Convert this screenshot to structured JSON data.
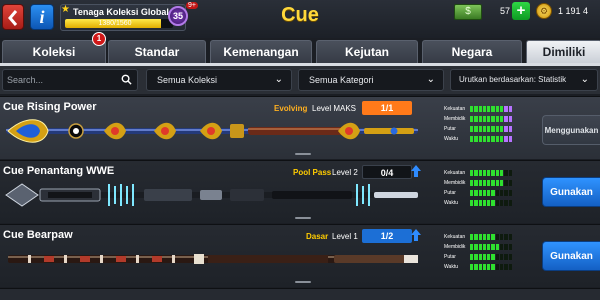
{
  "topbar": {
    "title": "Cue",
    "back_icon": "chevron-left-icon",
    "info_label": "i",
    "collection": {
      "title": "Tenaga Koleksi Global",
      "count": "1380/1560",
      "progress": 0.885,
      "level": "35",
      "level_plus": "9+"
    },
    "cash": {
      "value": "57",
      "add_label": "+"
    },
    "coins": {
      "value": "1 191 4"
    }
  },
  "tabs": [
    {
      "label": "Koleksi",
      "badge": "1"
    },
    {
      "label": "Standar"
    },
    {
      "label": "Kemenangan"
    },
    {
      "label": "Kejutan"
    },
    {
      "label": "Negara"
    },
    {
      "label": "Dimiliki",
      "active": true
    }
  ],
  "filters": {
    "search_placeholder": "Search...",
    "collection_filter": "Semua Koleksi",
    "category_filter": "Semua Kategori",
    "sort_filter": "Urutkan berdasarkan: Statistik"
  },
  "stat_labels": [
    "Kekuatan",
    "Membidik",
    "Putar",
    "Waktu"
  ],
  "cues": [
    {
      "name": "Cue Rising Power",
      "tier": "Evolving",
      "tier_color": "#ffb020",
      "level_text": "Level MAKS",
      "progress": "1/1",
      "progress_color": "#ff7a1a",
      "stats": [
        10,
        10,
        10,
        10
      ],
      "max_stats": true,
      "action": "Menggunakan",
      "action_type": "inuse"
    },
    {
      "name": "Cue Penantang WWE",
      "tier": "Pool Pass",
      "tier_color": "#ffcc00",
      "level_text": "Level 2",
      "progress": "0/4",
      "progress_color": "#111418",
      "stats": [
        8,
        8,
        6,
        6
      ],
      "max_stats": false,
      "action": "Gunakan",
      "action_type": "use"
    },
    {
      "name": "Cue Bearpaw",
      "tier": "Dasar",
      "tier_color": "#ffcc00",
      "level_text": "Level 1",
      "progress": "1/2",
      "progress_color": "#1c6fd6",
      "stats": [
        6,
        7,
        6,
        6
      ],
      "max_stats": false,
      "action": "Gunakan",
      "action_type": "use"
    }
  ]
}
